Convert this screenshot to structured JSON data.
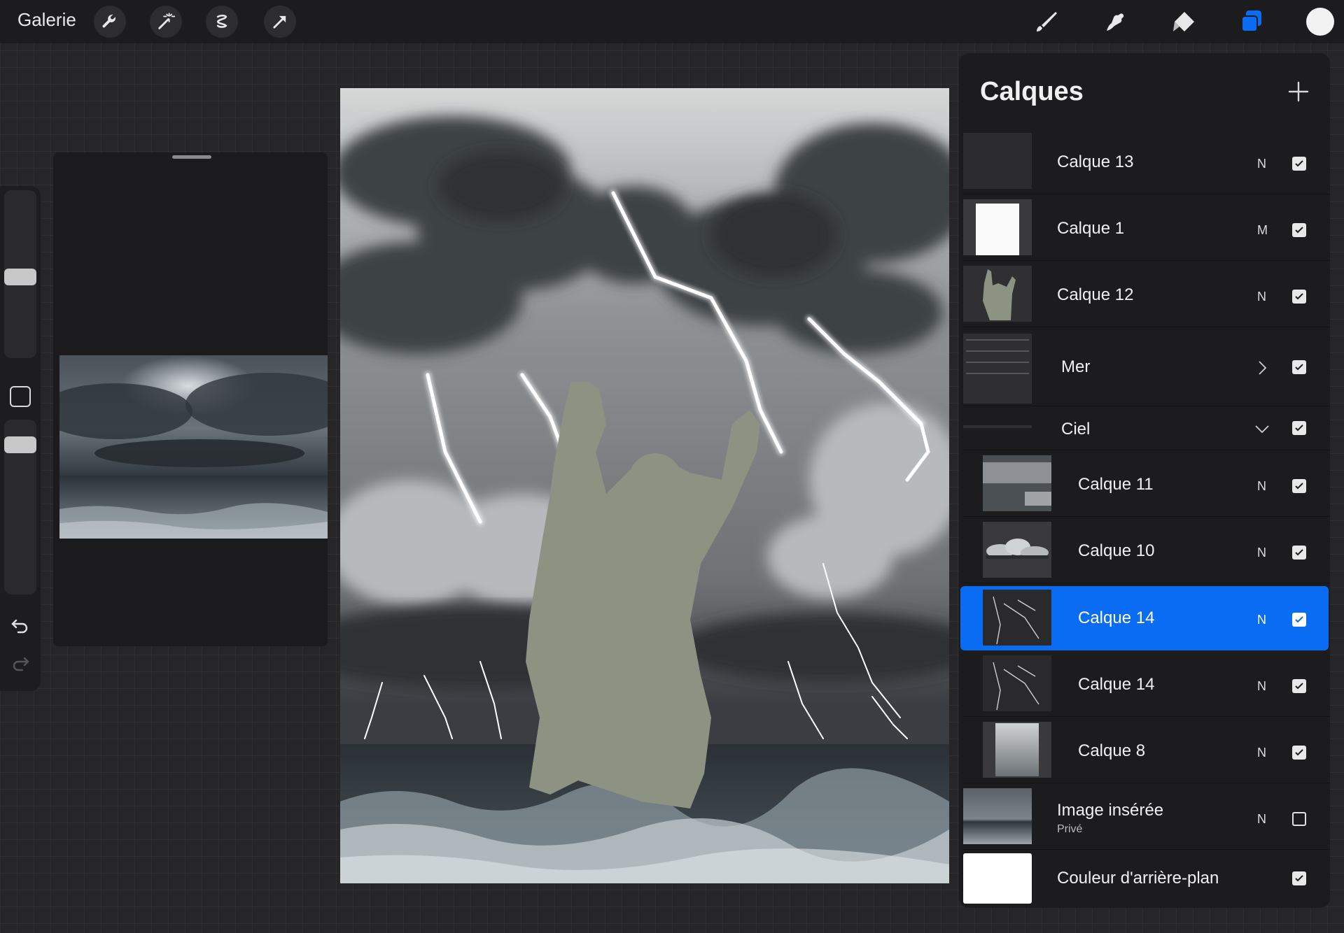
{
  "topbar": {
    "gallery_label": "Galerie",
    "left_tools": [
      "wrench-icon",
      "magic-wand-icon",
      "selection-icon",
      "transform-arrow-icon"
    ],
    "right_tools": [
      "brush-icon",
      "smudge-icon",
      "eraser-icon",
      "layers-icon"
    ],
    "active_tool": "layers",
    "current_color": "#f2f2f2",
    "accent": "#0a6cf2"
  },
  "layers_panel": {
    "title": "Calques",
    "layers": [
      {
        "name": "Calque 13",
        "mode": "N",
        "visible": true
      },
      {
        "name": "Calque 1",
        "mode": "M",
        "visible": true
      },
      {
        "name": "Calque 12",
        "mode": "N",
        "visible": true
      },
      {
        "name": "Mer",
        "type": "group",
        "expanded": false,
        "visible": true
      },
      {
        "name": "Ciel",
        "type": "group",
        "expanded": true,
        "visible": true
      },
      {
        "name": "Calque 11",
        "mode": "N",
        "visible": true
      },
      {
        "name": "Calque 10",
        "mode": "N",
        "visible": true
      },
      {
        "name": "Calque 14",
        "mode": "N",
        "visible": true,
        "selected": true
      },
      {
        "name": "Calque 14",
        "mode": "N",
        "visible": true
      },
      {
        "name": "Calque 8",
        "mode": "N",
        "visible": true
      },
      {
        "name": "Image insérée",
        "sublabel": "Privé",
        "mode": "N",
        "visible": false
      },
      {
        "name": "Couleur d'arrière-plan",
        "visible": true
      }
    ]
  }
}
